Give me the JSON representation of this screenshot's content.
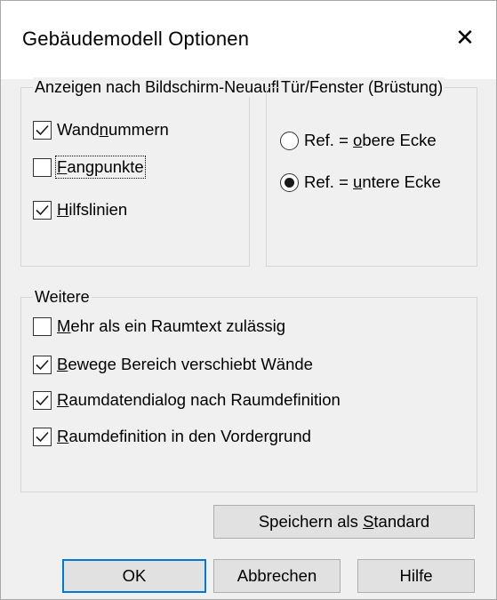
{
  "window": {
    "title": "Gebäudemodell Optionen",
    "close_symbol": "✕"
  },
  "display_group": {
    "legend": "Anzeigen nach Bildschirm-Neuaufbau",
    "items": [
      {
        "pre": "Wand",
        "ul": "n",
        "post": "ummern",
        "checked": true
      },
      {
        "pre": "",
        "ul": "F",
        "post": "angpunkte",
        "checked": false
      },
      {
        "pre": "",
        "ul": "H",
        "post": "ilfslinien",
        "checked": true
      }
    ]
  },
  "door_group": {
    "legend": "Tür/Fenster (Brüstung)",
    "radios": [
      {
        "pre": "Ref. = ",
        "ul": "o",
        "post": "bere Ecke",
        "selected": false
      },
      {
        "pre": "Ref. = ",
        "ul": "u",
        "post": "ntere Ecke",
        "selected": true
      }
    ]
  },
  "more_group": {
    "legend": "Weitere",
    "items": [
      {
        "pre": "",
        "ul": "M",
        "post": "ehr als ein Raumtext zulässig",
        "checked": false
      },
      {
        "pre": "",
        "ul": "B",
        "post": "ewege Bereich verschiebt  Wände",
        "checked": true
      },
      {
        "pre": "",
        "ul": "R",
        "post": "aumdatendialog nach Raumdefinition",
        "checked": true
      },
      {
        "pre": "",
        "ul": "R",
        "post": "aumdefinition in den Vordergrund",
        "checked": true
      }
    ]
  },
  "buttons": {
    "save_default": {
      "pre": "Speichern als ",
      "ul": "S",
      "post": "tandard"
    },
    "ok": "OK",
    "cancel": "Abbrechen",
    "help": "Hilfe"
  }
}
